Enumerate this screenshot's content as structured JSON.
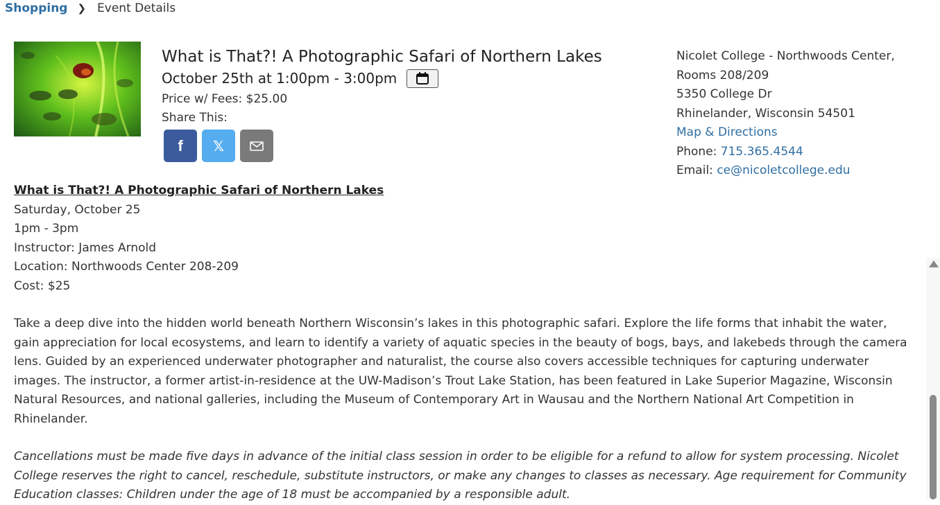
{
  "breadcrumb": {
    "parent": "Shopping",
    "current": "Event Details"
  },
  "event": {
    "title": "What is That?! A Photographic Safari of Northern Lakes",
    "when": "October 25th at 1:00pm - 3:00pm",
    "price": "Price w/ Fees: $25.00",
    "share_label": "Share This:",
    "share_buttons": {
      "facebook": "f",
      "x": "𝕏"
    }
  },
  "venue": {
    "name": "Nicolet College - Northwoods Center,",
    "rooms": "Rooms 208/209",
    "street": "5350 College Dr",
    "city": "Rhinelander, Wisconsin 54501",
    "map_link": "Map & Directions",
    "phone_label": "Phone:",
    "phone": "715.365.4544",
    "email_label": "Email:",
    "email": "ce@nicoletcollege.edu"
  },
  "details": {
    "heading": "What is That?! A Photographic Safari of Northern Lakes",
    "day": "Saturday, October 25",
    "time": "1pm - 3pm",
    "instructor": "Instructor: James Arnold",
    "location": "Location: Northwoods Center 208-209",
    "cost": "Cost: $25",
    "description": "Take a deep dive into the hidden world beneath Northern Wisconsin’s lakes in this photographic safari. Explore the life forms that inhabit the water, gain appreciation for local ecosystems, and learn to identify a variety of aquatic species in the beauty of bogs, bays, and lakebeds through the camera lens. Guided by an experienced underwater photographer and naturalist, the course also covers accessible techniques for capturing underwater images. The instructor, a former artist-in-residence at the UW-Madison’s Trout Lake Station, has been featured in Lake Superior Magazine, Wisconsin Natural Resources, and national galleries, including the Museum of Contemporary Art in Wausau and the Northern National Art Competition in Rhinelander.",
    "policy": "Cancellations must be made five days in advance of the initial class session in order to be eligible for a refund to allow for system processing. Nicolet College reserves the right to cancel, reschedule, substitute instructors, or make any changes to classes as necessary. Age requirement for Community Education classes: Children under the age of 18 must be accompanied by a responsible adult."
  },
  "colors": {
    "link": "#2f6ea3",
    "facebook": "#3b5b9c",
    "x": "#55acee",
    "email": "#7a7a7a"
  }
}
